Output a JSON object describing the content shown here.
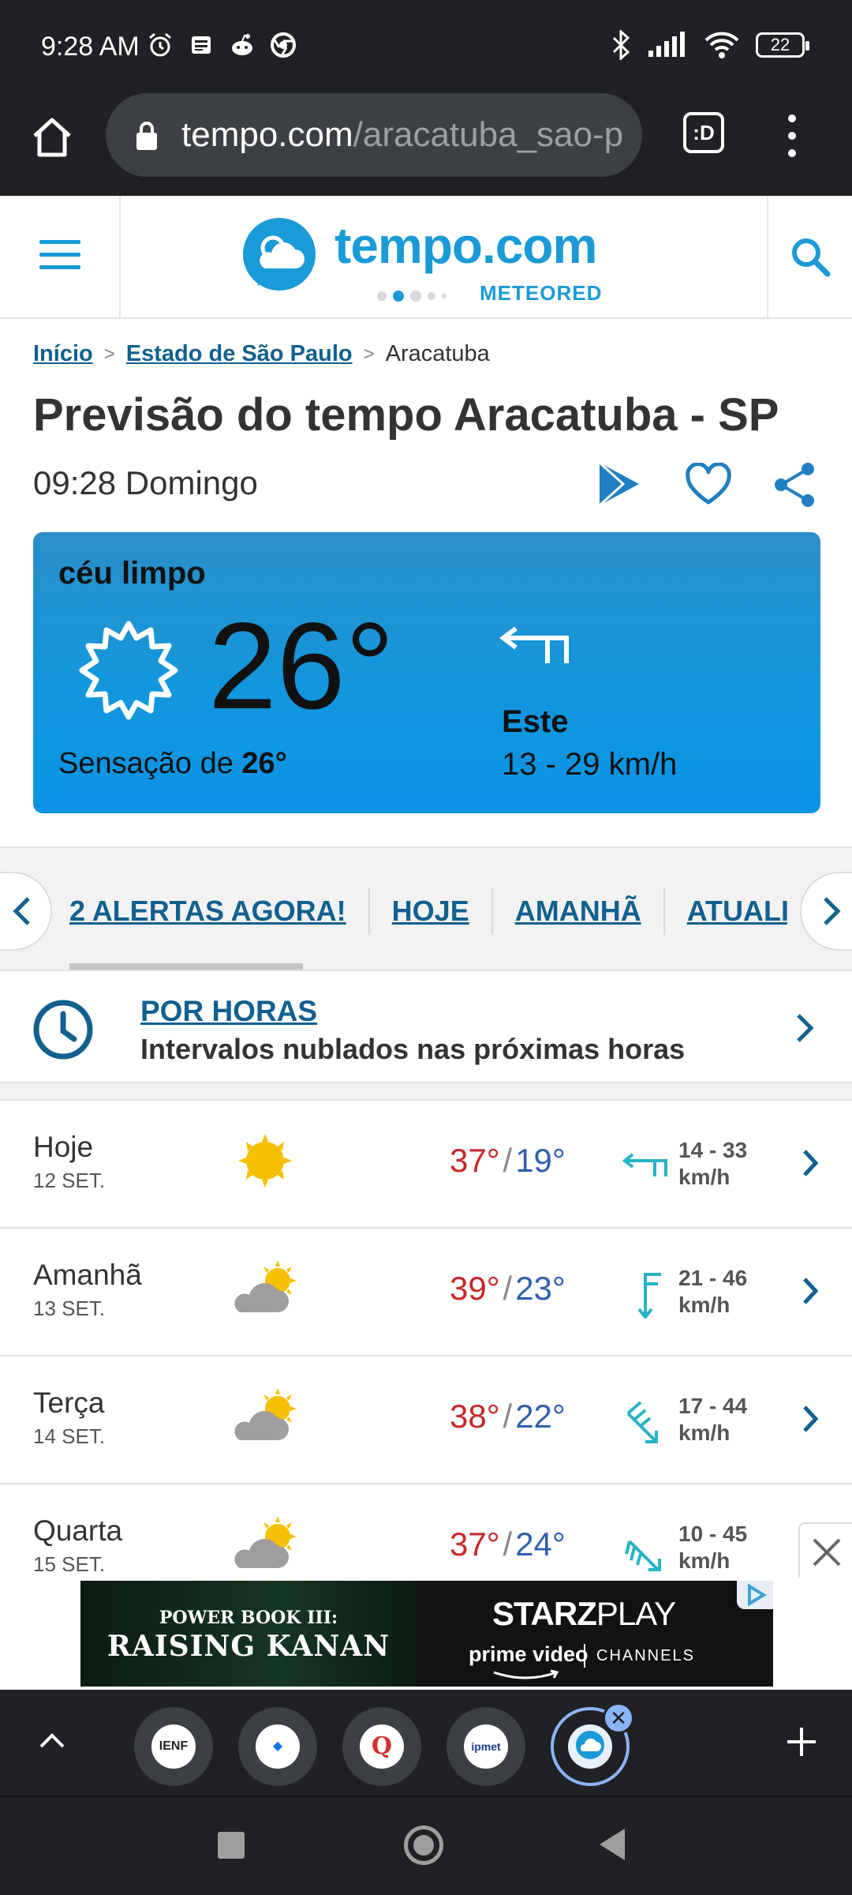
{
  "status_bar": {
    "time": "9:28 AM",
    "battery": "22",
    "icons_left": [
      "alarm-icon",
      "news-icon",
      "reddit-icon",
      "chrome-icon"
    ],
    "icons_right": [
      "bluetooth-icon",
      "signal-icon",
      "wifi-icon",
      "battery-icon"
    ]
  },
  "browser": {
    "url_host": "tempo.com",
    "url_path": "/aracatuba_sao-p",
    "tab_switcher_label": ":D"
  },
  "site_header": {
    "logo_word": "tempo.com",
    "logo_sub": "METEORED"
  },
  "breadcrumb": {
    "items": [
      "Início",
      "Estado de São Paulo"
    ],
    "current": "Aracatuba",
    "separator": ">"
  },
  "page": {
    "title": "Previsão do tempo Aracatuba - SP",
    "datetime": "09:28 Domingo"
  },
  "current": {
    "condition": "céu limpo",
    "temperature": "26°",
    "feels_prefix": "Sensação de",
    "feels_value": "26°",
    "wind_direction": "Este",
    "wind_speed": "13 - 29 km/h"
  },
  "tabs": {
    "items": [
      "2 ALERTAS AGORA!",
      "HOJE",
      "AMANHÃ",
      "ATUALI"
    ]
  },
  "hourly": {
    "title": "POR HORAS",
    "subtitle": "Intervalos nublados nas próximas horas"
  },
  "forecast": [
    {
      "day": "Hoje",
      "date": "12 SET.",
      "icon": "sun-icon",
      "max": "37°",
      "min": "19°",
      "wind_line1": "14 - 33",
      "wind_line2": "km/h",
      "wind_icon": "wind-east-icon"
    },
    {
      "day": "Amanhã",
      "date": "13 SET.",
      "icon": "partly-cloudy-icon",
      "max": "39°",
      "min": "23°",
      "wind_line1": "21 - 46",
      "wind_line2": "km/h",
      "wind_icon": "wind-north-icon"
    },
    {
      "day": "Terça",
      "date": "14 SET.",
      "icon": "partly-cloudy-icon",
      "max": "38°",
      "min": "22°",
      "wind_line1": "17 - 44",
      "wind_line2": "km/h",
      "wind_icon": "wind-northeast-icon"
    },
    {
      "day": "Quarta",
      "date": "15 SET.",
      "icon": "partly-cloudy-icon",
      "max": "37°",
      "min": "24°",
      "wind_line1": "10 - 45",
      "wind_line2": "km/h",
      "wind_icon": "wind-northwest-icon"
    }
  ],
  "ad": {
    "left_line1": "POWER BOOK III:",
    "left_line2": "RAISING KANAN",
    "starz": "STARZ",
    "play": "PLAY",
    "prime": "prime video",
    "channels": "CHANNELS"
  },
  "bottom_tabs": [
    {
      "label": "IENF"
    },
    {
      "label": "◆"
    },
    {
      "label": "Q"
    },
    {
      "label": "ipmet"
    },
    {
      "label": "tempo"
    }
  ],
  "colors": {
    "brand": "#1a9ad6",
    "link": "#11608f",
    "temp_max": "#c62828",
    "temp_min": "#2f5fae",
    "card_top": "#2b8fc9",
    "card_bottom": "#0a94e6",
    "chrome_dark": "#202124"
  }
}
